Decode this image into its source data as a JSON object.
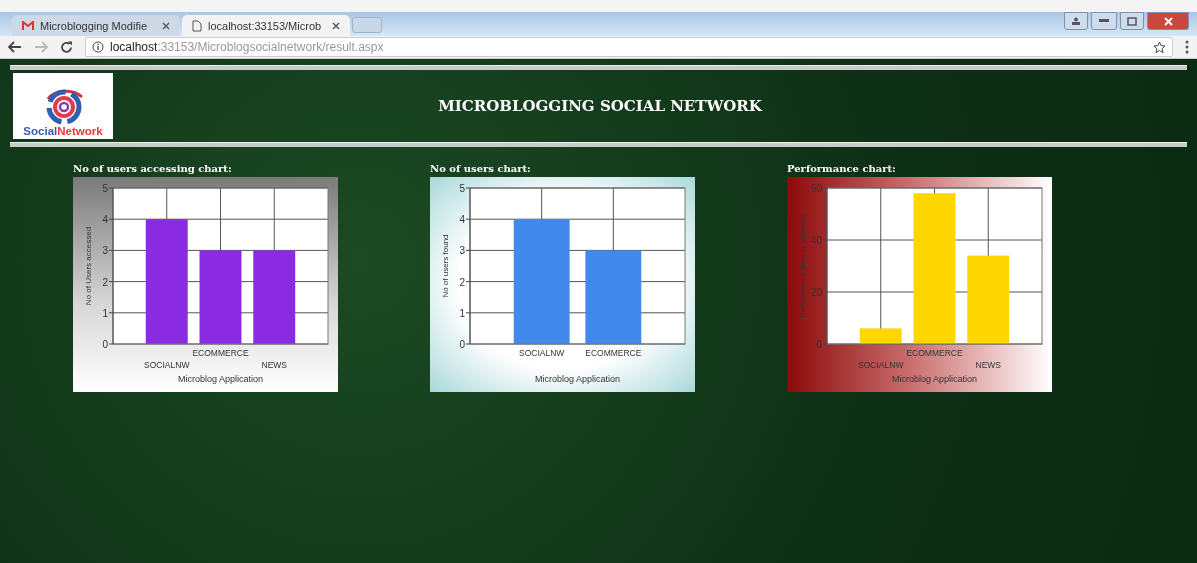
{
  "browser": {
    "tabs": [
      {
        "title": "Microblogging Modifie",
        "kind": "mail",
        "selected": false
      },
      {
        "title": "localhost:33153/Microb",
        "kind": "page",
        "selected": true
      }
    ],
    "address": {
      "host": "localhost",
      "rest": ":33153/Microblogsocialnetwork/result.aspx"
    }
  },
  "logo": {
    "parts": [
      "Social",
      "Network"
    ]
  },
  "title": "MICROBLOGGING SOCIAL NETWORK",
  "charts": [
    {
      "heading": "No of users accessing chart:",
      "kind": "gray",
      "chart_data": {
        "type": "bar",
        "grid": true,
        "xlabel": "Microblog Application",
        "ylabel": "No of Users accessed",
        "categories": [
          "SOCIALNW",
          "ECOMMERCE",
          "NEWS"
        ],
        "series": [
          {
            "color": "#8a2be2",
            "values": [
              4,
              3,
              3
            ]
          }
        ],
        "ylim": [
          0,
          5
        ],
        "yticks": [
          0,
          1,
          2,
          3,
          4,
          5
        ]
      }
    },
    {
      "heading": "No of users chart:",
      "kind": "teal",
      "chart_data": {
        "type": "bar",
        "grid": true,
        "xlabel": "Microblog Application",
        "ylabel": "No of users found",
        "categories": [
          "SOCIALNW",
          "ECOMMERCE"
        ],
        "series": [
          {
            "color": "#4189ea",
            "values": [
              4,
              3
            ]
          }
        ],
        "ylim": [
          0,
          5
        ],
        "yticks": [
          0,
          1,
          2,
          3,
          4,
          5
        ]
      }
    },
    {
      "heading": "Performance chart:",
      "kind": "red",
      "chart_data": {
        "type": "bar",
        "grid": true,
        "xlabel": "Microblog Application",
        "ylabel": "Performance time in seconds",
        "categories": [
          "SOCIALNW",
          "ECOMMERCE",
          "NEWS"
        ],
        "series": [
          {
            "color": "#ffd700",
            "values": [
              6,
              58,
              34
            ]
          }
        ],
        "ylim": [
          0,
          60
        ],
        "yticks": [
          0,
          20,
          40,
          60
        ]
      }
    }
  ]
}
